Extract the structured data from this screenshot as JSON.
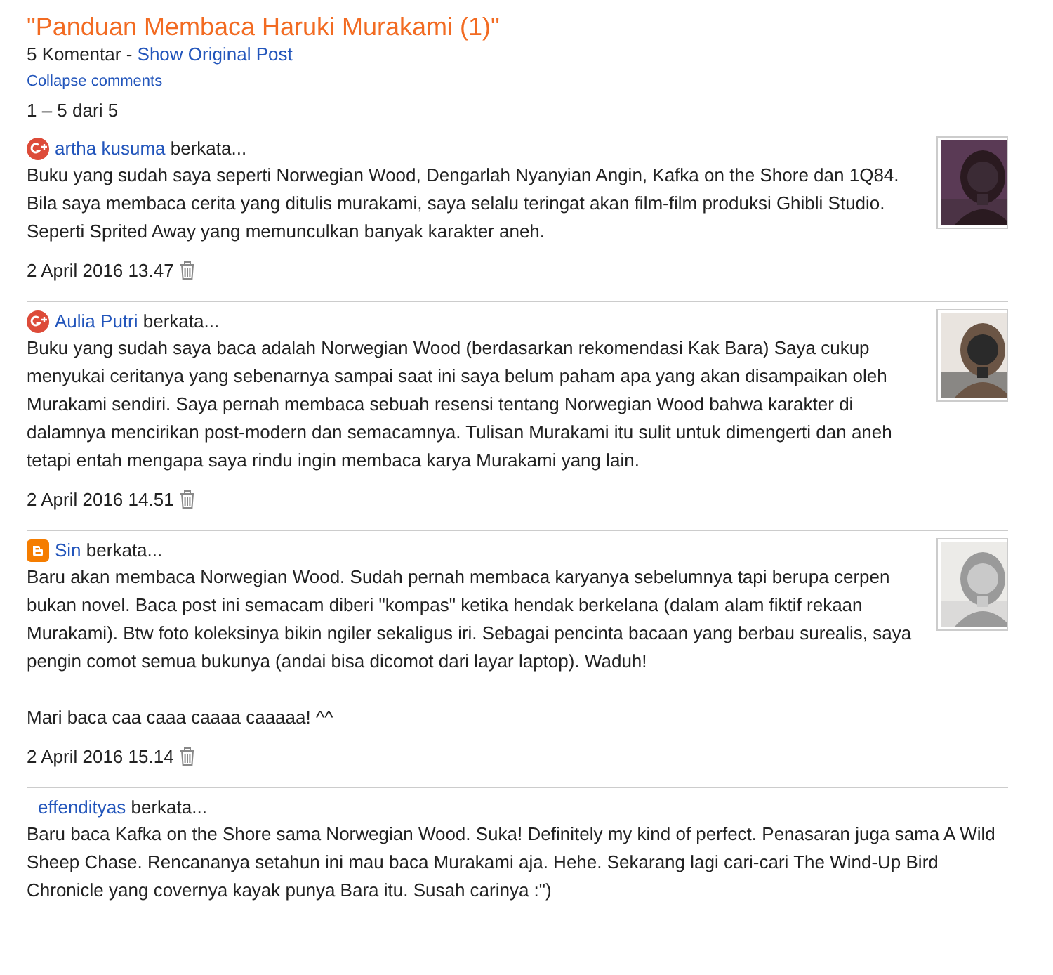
{
  "post_title": "\"Panduan Membaca Haruki Murakami (1)\"",
  "comment_count": "5 Komentar -",
  "show_original_link": "Show Original Post",
  "collapse_link": "Collapse comments",
  "pagination": "1 – 5 dari 5",
  "comments": [
    {
      "kind": "google",
      "author": "artha kusuma",
      "says": "berkata...",
      "avatar": {
        "kind": "picture"
      },
      "paragraphs": [
        "Buku yang sudah saya seperti Norwegian Wood, Dengarlah Nyanyian Angin, Kafka on the Shore dan 1Q84. Bila saya membaca cerita yang ditulis murakami, saya selalu teringat akan film-film produksi Ghibli Studio. Seperti Sprited Away yang memunculkan banyak karakter aneh."
      ],
      "date": "2 April 2016 13.47"
    },
    {
      "kind": "google",
      "author": "Aulia Putri",
      "says": "berkata...",
      "avatar": {
        "kind": "picture"
      },
      "paragraphs": [
        "Buku yang sudah saya baca adalah Norwegian Wood (berdasarkan rekomendasi Kak Bara) Saya cukup menyukai ceritanya yang sebenarnya sampai saat ini saya belum paham apa yang akan disampaikan oleh Murakami sendiri. Saya pernah membaca sebuah resensi tentang Norwegian Wood bahwa karakter di dalamnya mencirikan post-modern dan semacamnya. Tulisan Murakami itu sulit untuk dimengerti dan aneh tetapi entah mengapa saya rindu ingin membaca karya Murakami yang lain."
      ],
      "date": "2 April 2016 14.51"
    },
    {
      "kind": "blogger",
      "author": "Sin",
      "says": "berkata...",
      "avatar": {
        "kind": "picture"
      },
      "paragraphs": [
        "Baru akan membaca Norwegian Wood. Sudah pernah membaca karyanya sebelumnya tapi berupa cerpen bukan novel. Baca post ini semacam diberi \"kompas\" ketika hendak berkelana (dalam alam fiktif rekaan Murakami). Btw foto koleksinya bikin ngiler sekaligus iri. Sebagai pencinta bacaan yang berbau surealis, saya pengin comot semua bukunya (andai bisa dicomot dari layar laptop). Waduh!",
        "Mari baca caa caaa caaaa caaaaa! ^^"
      ],
      "date": "2 April 2016 15.14"
    },
    {
      "kind": "none",
      "author": "effendityas",
      "says": "berkata...",
      "paragraphs": [
        "Baru baca Kafka on the Shore sama Norwegian Wood. Suka! Definitely my kind of perfect. Penasaran juga sama A Wild Sheep Chase. Rencananya setahun ini mau baca Murakami aja. Hehe. Sekarang lagi cari-cari The Wind-Up Bird Chronicle yang covernya kayak punya Bara itu. Susah carinya :\")"
      ]
    }
  ]
}
